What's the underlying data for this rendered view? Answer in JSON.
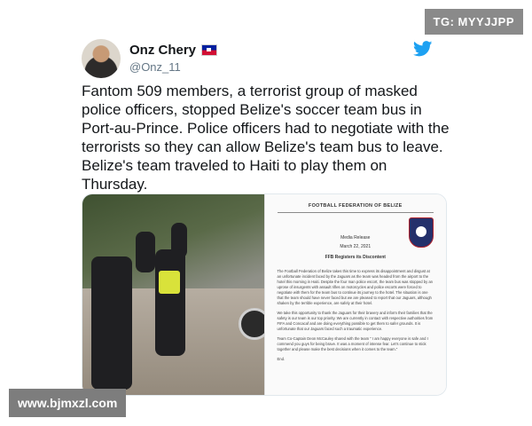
{
  "watermarks": {
    "top_right": "TG: MYYJJPP",
    "bottom_left": "www.bjmxzl.com"
  },
  "tweet": {
    "author_name": "Onz Chery",
    "author_handle": "@Onz_11",
    "flag": "haiti-flag",
    "platform_icon": "twitter-bird-icon",
    "text": "Fantom 509 members, a terrorist group of masked police officers, stopped Belize's soccer team bus in Port-au-Prince. Police officers had to negotiate with the terrorists so they can allow Belize's team bus to leave. Belize's team traveled to Haiti to play them on Thursday.",
    "media": {
      "document": {
        "header": "FOOTBALL FEDERATION OF BELIZE",
        "label": "Media Release",
        "date": "March 22, 2021",
        "title": "FFB Registers its Discontent",
        "paragraphs": [
          "The Football Federation of Belize takes this time to express its disappointment and disgust at an unfortunate incident faced by the Jaguars as the team was headed from the airport to the hotel this morning in Haiti. Despite the four man police escort, the team bus was stopped by an uprose of insurgents with assault rifles on motorcycles and police escorts were forced to negotiate with them for the team bus to continue its journey to the hotel. The situation is one that the team should have never faced but we are pleased to report that our Jaguars, although shaken by the terrible experience, are safely at their hotel.",
          "We take this opportunity to thank the Jaguars for their bravery and inform their families that the safety is our team is our top priority. We are currently in contact with respective authorities from FIFA and Concacaf and are doing everything possible to get them to safer grounds. It is unfortunate that our Jaguars faced such a traumatic experience.",
          "Team Co-Captain Deon McCauley shared with the team \" I am happy everyone is safe and I commend you guys for being brave. It was a moment of intense fear. Let's continue to stick together and please make the best decisions when it comes to the team.\"",
          "End."
        ]
      }
    }
  },
  "colors": {
    "twitter_blue": "#1da1f2",
    "text": "#14171a",
    "handle": "#657786"
  }
}
